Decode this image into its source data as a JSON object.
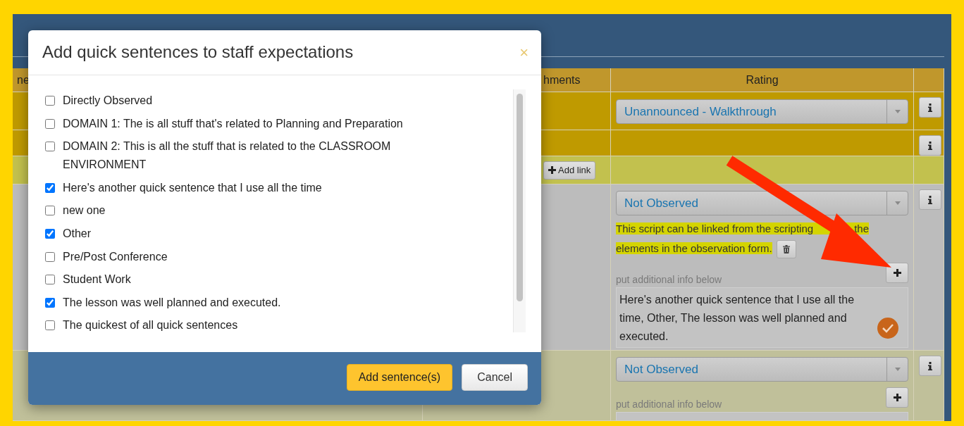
{
  "table": {
    "columns": [
      "ne",
      "hments",
      "Rating"
    ],
    "rows": [
      {
        "kind": "rating",
        "rating": "Unannounced - Walkthrough"
      },
      {
        "kind": "section"
      },
      {
        "kind": "links",
        "add_link": "Add link"
      },
      {
        "kind": "criterion",
        "rating": "Not Observed",
        "note": [
          "This script can be linked from the scripting",
          "the",
          "elements in the observation form."
        ],
        "prompt": "put additional info below",
        "additional_text": "Here's another quick sentence that I use all the time, Other, The lesson was well planned and executed.",
        "saved": true
      },
      {
        "kind": "criterion",
        "rating": "Not Observed",
        "prompt": "put additional info below",
        "saved": false
      }
    ]
  },
  "modal": {
    "title": "Add quick sentences to staff expectations",
    "close": "×",
    "items": [
      {
        "label": "Directly Observed",
        "checked": false
      },
      {
        "label": "DOMAIN 1: The is all stuff that's related to Planning and Preparation",
        "checked": false
      },
      {
        "label": "DOMAIN 2: This is all the stuff that is related to the CLASSROOM ENVIRONMENT",
        "checked": false
      },
      {
        "label": "Here's another quick sentence that I use all the time",
        "checked": true
      },
      {
        "label": "new one",
        "checked": false
      },
      {
        "label": "Other",
        "checked": true
      },
      {
        "label": "Pre/Post Conference",
        "checked": false
      },
      {
        "label": "Student Work",
        "checked": false
      },
      {
        "label": "The lesson was well planned and executed.",
        "checked": true
      },
      {
        "label": "The quickest of all quick sentences",
        "checked": false
      }
    ],
    "buttons": [
      {
        "label": "Add sentence(s)",
        "kind": "primary"
      },
      {
        "label": "Cancel",
        "kind": "default"
      }
    ]
  }
}
